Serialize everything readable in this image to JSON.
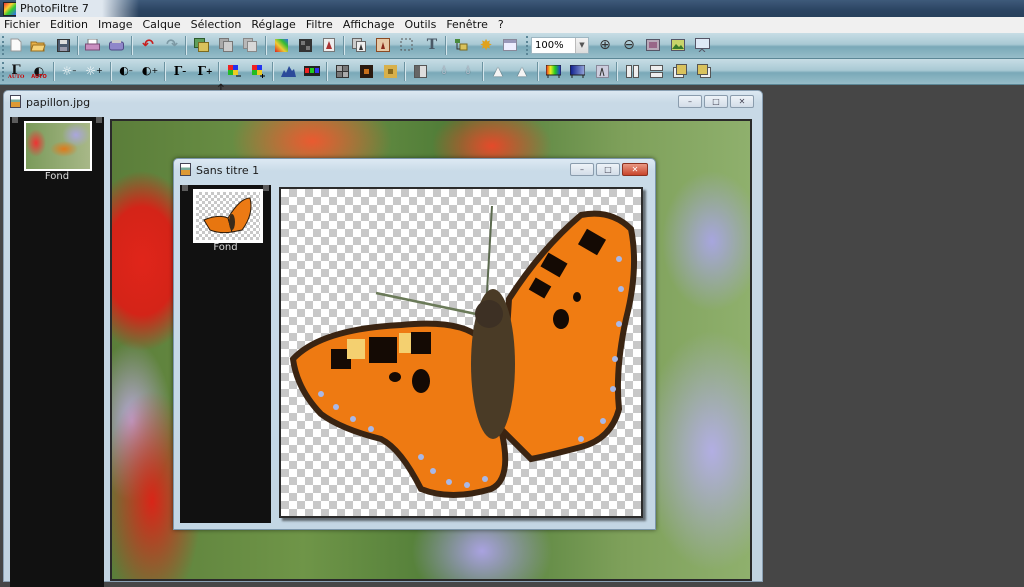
{
  "app": {
    "title": "PhotoFiltre 7"
  },
  "menu": [
    "Fichier",
    "Edition",
    "Image",
    "Calque",
    "Sélection",
    "Réglage",
    "Filtre",
    "Affichage",
    "Outils",
    "Fenêtre",
    "?"
  ],
  "toolbar1": {
    "icons": [
      "new-icon",
      "open-icon",
      "save-icon",
      "print-icon",
      "scan-icon",
      "undo-icon",
      "redo-icon",
      "paste-as-image-icon",
      "copy-icon",
      "paste-icon",
      "gradient-icon",
      "pattern-icon",
      "transparency-icon",
      "duplicate-icon",
      "crop-icon",
      "selection-icon",
      "text-icon",
      "layers-icon",
      "effects-icon",
      "browser-icon",
      "zoom-in-icon",
      "zoom-out-icon",
      "fit-icon",
      "full-size-icon",
      "fullscreen-icon"
    ],
    "zoom_value": "100%"
  },
  "toolbar2": {
    "icons": [
      "auto-levels-icon",
      "auto-contrast-icon",
      "brightness-minus-icon",
      "brightness-plus-icon",
      "contrast-minus-icon",
      "contrast-plus-icon",
      "gamma-minus-icon",
      "gamma-plus-icon",
      "saturation-minus-icon",
      "saturation-plus-icon",
      "histogram-icon",
      "rgb-icon",
      "frame-icon",
      "texture-icon",
      "mosaic-icon",
      "grayscale-icon",
      "blur-icon",
      "blur-more-icon",
      "sharpen-icon",
      "sharpen-more-icon",
      "color-balance-icon",
      "gradient-map-icon",
      "mirror-icon",
      "flip-horizontal-icon",
      "flip-vertical-icon",
      "rotate-left-icon",
      "rotate-right-icon"
    ],
    "auto_label": "AUTO"
  },
  "windows": {
    "photo": {
      "title": "papillon.jpg",
      "layer_label": "Fond",
      "buttons": {
        "minimize": "–",
        "maximize": "□",
        "close": "✕"
      }
    },
    "sans_titre": {
      "title": "Sans titre 1",
      "layer_label": "Fond",
      "buttons": {
        "minimize": "–",
        "maximize": "□",
        "close": "✕"
      }
    }
  }
}
